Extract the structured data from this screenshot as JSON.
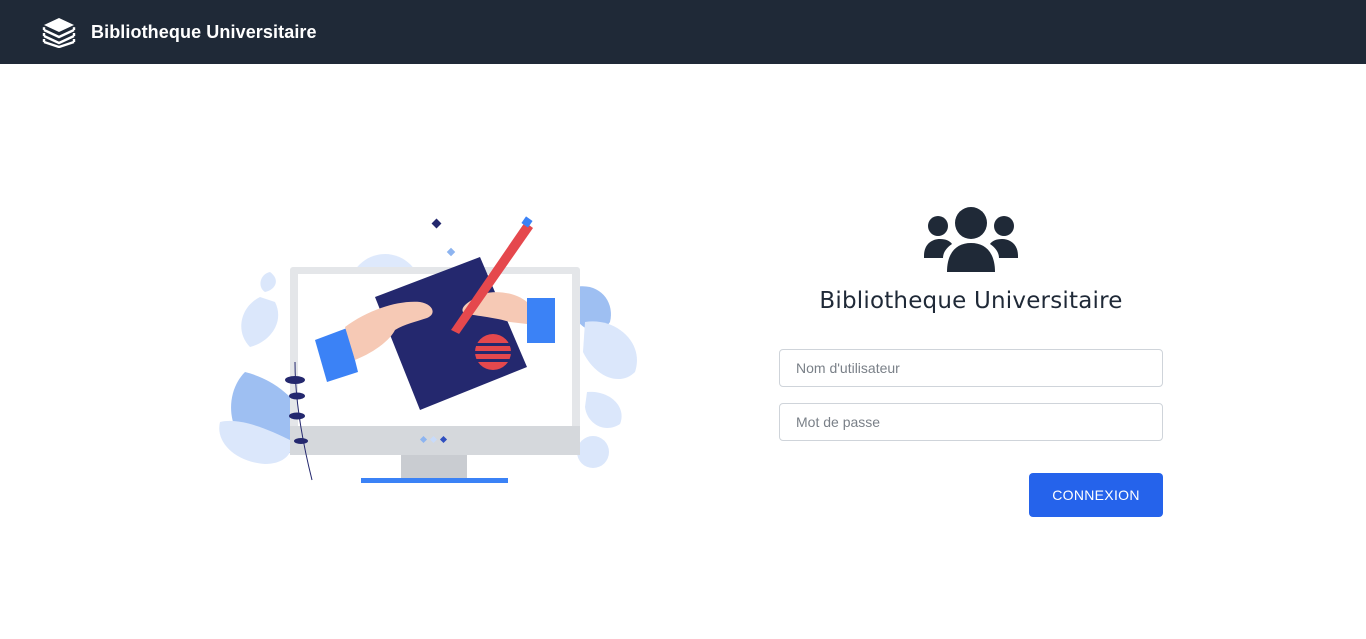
{
  "navbar": {
    "brand_icon": "stacked-books-icon",
    "brand_title": "Bibliotheque Universitaire",
    "background": "#1f2937"
  },
  "illustration": {
    "icon": "computer-signing-illustration"
  },
  "login": {
    "icon": "users-icon",
    "title": "Bibliotheque Universitaire",
    "username_placeholder": "Nom d'utilisateur",
    "password_placeholder": "Mot de passe",
    "username_value": "",
    "password_value": "",
    "submit_label": "CONNEXION",
    "accent": "#2563eb"
  }
}
